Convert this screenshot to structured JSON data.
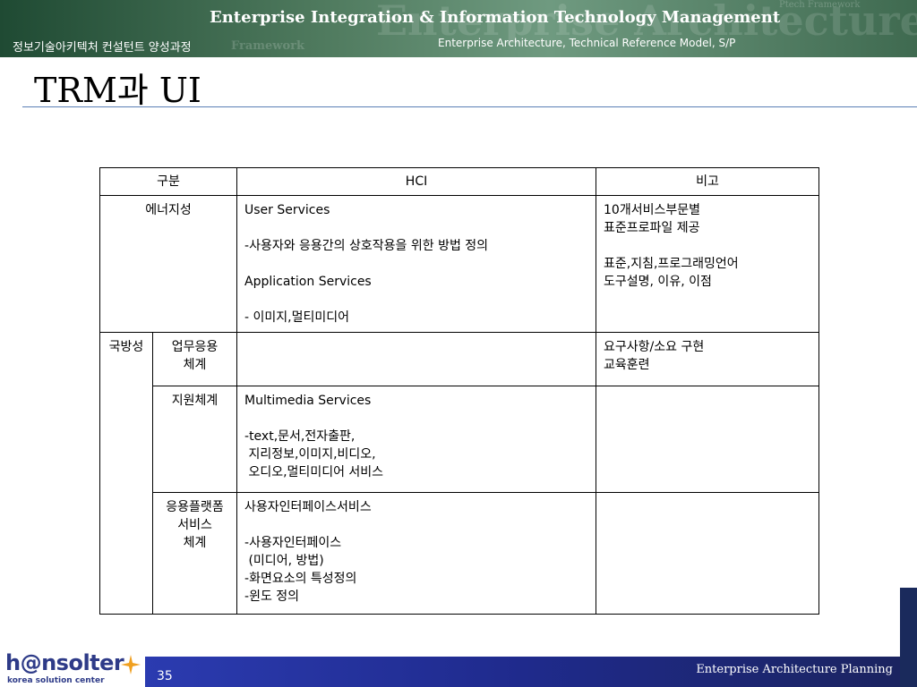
{
  "header": {
    "title": "Enterprise Integration & Information Technology Management",
    "course": "정보기술아키텍처 컨설턴트 양성과정",
    "subtitle": "Enterprise Architecture, Technical Reference Model, S/P",
    "bg_watermark": "Enterprise Architecture Model",
    "bg_watermark2": "Framework",
    "bg_watermark3": "Ptech Framework"
  },
  "page_title": "TRM과 UI",
  "table": {
    "headers": [
      "구분",
      "HCI",
      "비고"
    ],
    "rows": [
      {
        "category": "에너지성",
        "hci": [
          "User Services",
          "",
          "-사용자와 응용간의 상호작용을 위한 방법 정의",
          "",
          "Application Services",
          "",
          "- 이미지,멀티미디어"
        ],
        "note": [
          "10개서비스부문별",
          "표준프로파일 제공",
          "",
          "표준,지침,프로그래밍언어",
          "도구설명, 이유, 이점"
        ]
      },
      {
        "category": "국방성",
        "subrows": [
          {
            "sub": [
              "업무응용",
              "체계"
            ],
            "hci": [],
            "note": [
              "요구사항/소요 구현",
              "교육훈련"
            ]
          },
          {
            "sub": [
              "지원체계"
            ],
            "hci": [
              "Multimedia Services",
              "",
              "-text,문서,전자출판,",
              " 지리정보,이미지,비디오,",
              " 오디오,멀티미디어 서비스"
            ],
            "note": []
          },
          {
            "sub": [
              "응용플랫폼",
              "서비스",
              "체계"
            ],
            "hci": [
              "사용자인터페이스서비스",
              "",
              "-사용자인터페이스",
              " (미디어, 방법)",
              "-화면요소의 특성정의",
              "-윈도 정의"
            ],
            "note": []
          }
        ]
      }
    ]
  },
  "footer": {
    "page_number": "35",
    "title": "Enterprise Architecture Planning",
    "logo_name": "h@nsolter",
    "logo_tagline": "korea solution center"
  },
  "colors": {
    "banner": "#3f6a50",
    "title_rule": "#5a7fb5",
    "footer_bar": "#1f2a8c",
    "logo": "#2e3b88",
    "logo_star": "#f0a020"
  }
}
